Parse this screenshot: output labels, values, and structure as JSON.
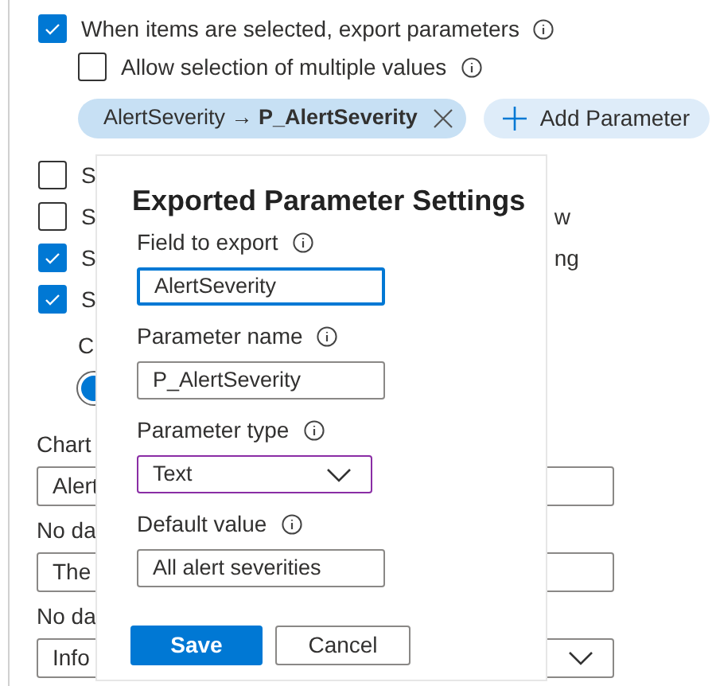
{
  "export_option": {
    "label": "When items are selected, export parameters",
    "checked": true
  },
  "multi_option": {
    "label": "Allow selection of multiple values",
    "checked": false
  },
  "parameter_chip": {
    "text": "AlertSeverity → **P_AlertSeverity**"
  },
  "add_button": {
    "label": "Add Parameter"
  },
  "hidden_rows": [
    {
      "label": "S",
      "checked": false,
      "suffix": ""
    },
    {
      "label": "S",
      "checked": false,
      "suffix": "w"
    },
    {
      "label": "S",
      "checked": true,
      "suffix": "ng"
    },
    {
      "label": "S",
      "checked": true,
      "suffix": ""
    }
  ],
  "color_label": "C",
  "fields": [
    {
      "kind": "input",
      "label": "Chart",
      "value": "Alert"
    },
    {
      "kind": "input",
      "label": "No da",
      "value": "The"
    },
    {
      "kind": "dropdown",
      "label": "No da",
      "value": "Info"
    }
  ],
  "dialog": {
    "title": "Exported Parameter Settings",
    "fields": [
      {
        "kind": "input",
        "label": "Field to export",
        "value": "AlertSeverity",
        "focused": true,
        "hovered": false
      },
      {
        "kind": "input",
        "label": "Parameter name",
        "value": "P_AlertSeverity",
        "focused": false,
        "hovered": false
      },
      {
        "kind": "dropdown",
        "label": "Parameter type",
        "value": "Text",
        "focused": false,
        "hovered": true
      },
      {
        "kind": "input",
        "label": "Default value",
        "value": "All alert severities",
        "focused": false,
        "hovered": false
      }
    ],
    "buttons": [
      {
        "label": "Save",
        "primary": true
      },
      {
        "label": "Cancel",
        "primary": false
      }
    ]
  }
}
